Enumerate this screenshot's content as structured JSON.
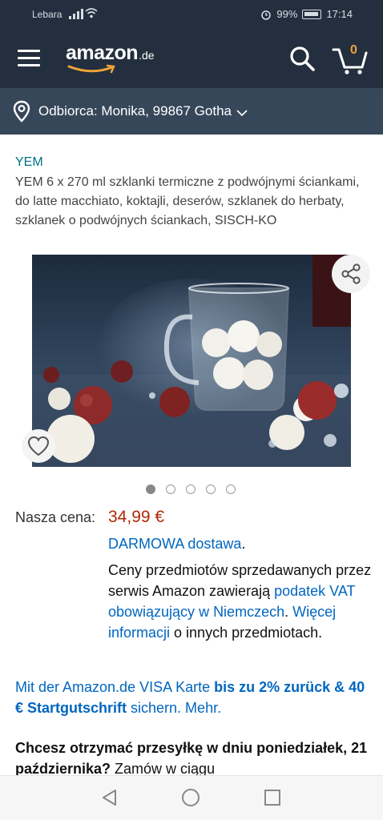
{
  "status_bar": {
    "carrier": "Lebara",
    "battery": "99%",
    "time": "17:14"
  },
  "nav": {
    "logo_text": "amazon",
    "logo_tld": ".de",
    "cart_count": "0"
  },
  "delivery_bar": {
    "text": "Odbiorca: Monika, 99867 Gotha"
  },
  "product": {
    "brand": "YEM",
    "title": "YEM 6 x 270 ml szklanki termiczne z podwójnymi ściankami, do latte macchiato, koktajli, deserów, szklanek do herbaty, szklanek o podwójnych ściankach, SISCH-KO",
    "image_count": 5,
    "active_image": 1
  },
  "pricing": {
    "label": "Nasza cena:",
    "price": "34,99 €",
    "free_delivery": "DARMOWA dostawa",
    "free_delivery_suffix": ".",
    "vat_part1": "Ceny przedmiotów sprzedawanych przez serwis Amazon zawierają ",
    "vat_link": "podatek VAT obowiązujący w Niemczech",
    "vat_part2": ". ",
    "more_info_link": "Więcej informacji",
    "vat_part3": " o innych przedmiotach."
  },
  "visa_promo": {
    "part1": "Mit der Amazon.de VISA Karte ",
    "bold": "bis zu 2% zurück & 40 € Startgutschrift",
    "part2": " sichern. Mehr."
  },
  "delivery_question": {
    "bold": "Chcesz otrzymać przesyłkę w dniu poniedziałek, 21 października?",
    "rest": " Zamów w ciągu"
  },
  "colors": {
    "header_bg": "#232f3e",
    "subheader_bg": "#37475a",
    "link": "#0066c0",
    "price": "#b12704",
    "cart_accent": "#f0a33a"
  }
}
